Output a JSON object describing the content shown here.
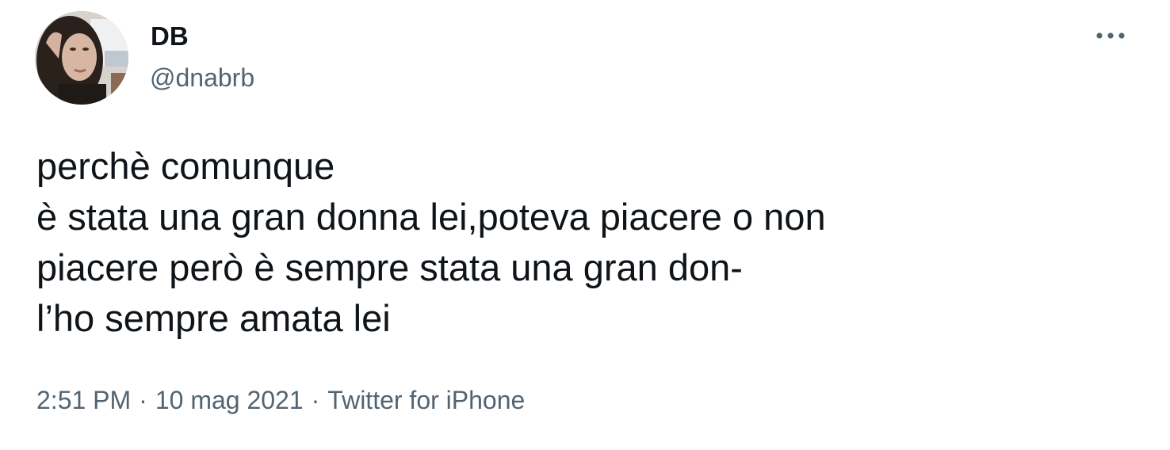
{
  "author": {
    "display_name": "DB",
    "handle": "@dnabrb"
  },
  "more_icon": "more-horizontal-icon",
  "tweet": {
    "lines": [
      "perchè comunque",
      "è stata una gran donna lei,poteva piacere o non",
      "piacere però è sempre stata una gran don-",
      "l’ho sempre amata lei"
    ]
  },
  "meta": {
    "time": "2:51 PM",
    "separator": "·",
    "date": "10 mag 2021",
    "source": "Twitter for iPhone"
  }
}
